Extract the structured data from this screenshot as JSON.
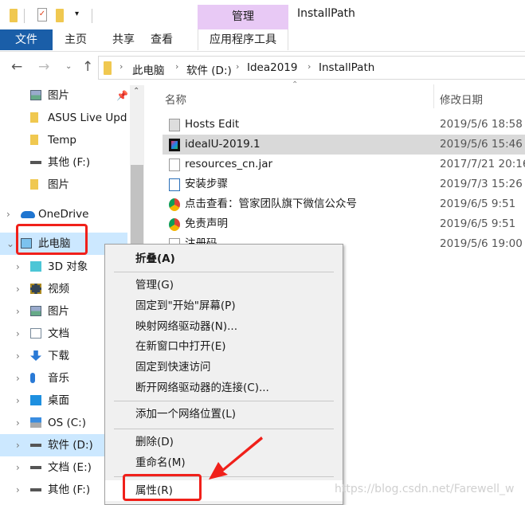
{
  "window": {
    "title": "InstallPath"
  },
  "ribbon": {
    "context_tab": "管理",
    "tabs": [
      "文件",
      "主页",
      "共享",
      "查看",
      "应用程序工具"
    ]
  },
  "address": {
    "crumbs": [
      "此电脑",
      "软件 (D:)",
      "Idea2019",
      "InstallPath"
    ]
  },
  "columns": {
    "name": "名称",
    "date": "修改日期"
  },
  "nav": {
    "items": [
      {
        "label": "图片",
        "icon": "pictures-icon",
        "pinned": true
      },
      {
        "label": "ASUS Live Upda",
        "icon": "folder-icon"
      },
      {
        "label": "Temp",
        "icon": "folder-icon"
      },
      {
        "label": "其他 (F:)",
        "icon": "drive-icon"
      },
      {
        "label": "图片",
        "icon": "folder-icon"
      },
      {
        "label": "OneDrive",
        "icon": "onedrive-icon"
      },
      {
        "label": "此电脑",
        "icon": "computer-icon",
        "selected": true
      },
      {
        "label": "3D 对象",
        "icon": "3d-objects-icon"
      },
      {
        "label": "视频",
        "icon": "video-icon"
      },
      {
        "label": "图片",
        "icon": "pictures-icon"
      },
      {
        "label": "文档",
        "icon": "documents-icon"
      },
      {
        "label": "下载",
        "icon": "download-icon"
      },
      {
        "label": "音乐",
        "icon": "music-icon"
      },
      {
        "label": "桌面",
        "icon": "desktop-icon"
      },
      {
        "label": "OS (C:)",
        "icon": "os-drive-icon"
      },
      {
        "label": "软件 (D:)",
        "icon": "drive-icon",
        "selected": true
      },
      {
        "label": "文档 (E:)",
        "icon": "drive-icon"
      },
      {
        "label": "其他 (F:)",
        "icon": "drive-icon"
      }
    ]
  },
  "files": [
    {
      "name": "Hosts Edit",
      "date": "2019/5/6 18:58",
      "icon": "shortcut-icon"
    },
    {
      "name": "idealU-2019.1",
      "date": "2019/5/6 15:46",
      "icon": "intellij-icon",
      "selected": true
    },
    {
      "name": "resources_cn.jar",
      "date": "2017/7/21 20:16",
      "icon": "file-icon"
    },
    {
      "name": "安装步骤",
      "date": "2019/7/3 15:26",
      "icon": "image-file-icon"
    },
    {
      "name": "点击查看：管家团队旗下微信公众号",
      "date": "2019/6/5 9:51",
      "icon": "chrome-shortcut-icon"
    },
    {
      "name": "免责声明",
      "date": "2019/6/5 9:51",
      "icon": "chrome-shortcut-icon"
    },
    {
      "name": "注册码",
      "date": "2019/5/6 19:00",
      "icon": "text-file-icon"
    }
  ],
  "context_menu": {
    "items": [
      "折叠(A)",
      "管理(G)",
      "固定到\"开始\"屏幕(P)",
      "映射网络驱动器(N)...",
      "在新窗口中打开(E)",
      "固定到快速访问",
      "断开网络驱动器的连接(C)...",
      "添加一个网络位置(L)",
      "删除(D)",
      "重命名(M)",
      "属性(R)"
    ]
  },
  "watermark": "https://blog.csdn.net/Farewell_w",
  "colors": {
    "file_tab": "#1a5ea8",
    "context_tab": "#e8c9f5",
    "selection": "#cce8ff",
    "annotation": "#f0201a"
  }
}
